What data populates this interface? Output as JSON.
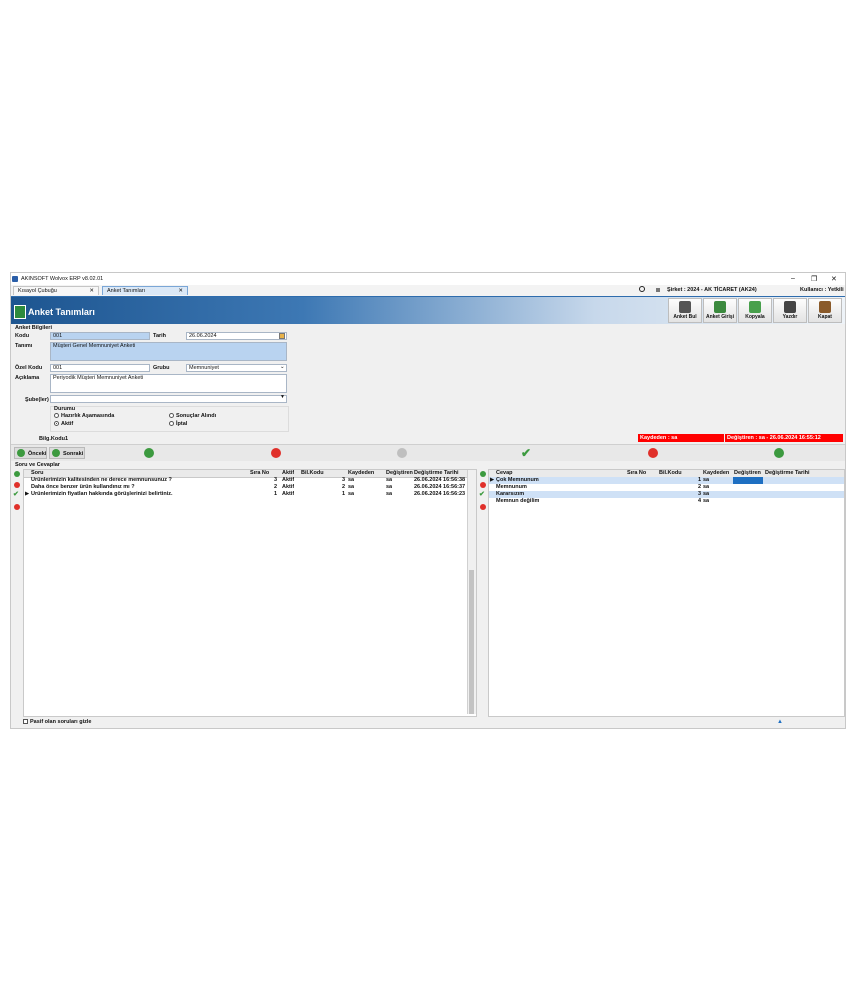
{
  "window": {
    "app_title": "AKINSOFT Wolvox ERP v8.02.01",
    "controls": {
      "minimize": "–",
      "restore": "❐",
      "close": "✕"
    },
    "company": "Şirket : 2024 - AK TİCARET (AK24)",
    "user": "Kullanıcı : Yetkili"
  },
  "tabs": [
    {
      "label": "Kısayol Çubuğu",
      "close": "✕"
    },
    {
      "label": "Anket Tanımları",
      "close": "✕"
    }
  ],
  "header": {
    "title": "Anket Tanımları"
  },
  "toolbar": [
    {
      "label": "Anket Bul",
      "icon": "camera-icon"
    },
    {
      "label": "Anket Girişi",
      "icon": "users-icon"
    },
    {
      "label": "Kopyala",
      "icon": "copy-icon"
    },
    {
      "label": "Yazdır",
      "icon": "printer-icon"
    },
    {
      "label": "Kapat",
      "icon": "door-icon"
    }
  ],
  "form": {
    "section_title": "Anket Bilgileri",
    "kodu_label": "Kodu",
    "kodu": "001",
    "tarih_label": "Tarih",
    "tarih": "26.06.2024",
    "tanimi_label": "Tanımı",
    "tanimi": "Müşteri Genel Memnuniyet Anketi",
    "ozel_kodu_label": "Özel Kodu",
    "ozel_kodu": "001",
    "grubu_label": "Grubu",
    "grubu": "Memnuniyet",
    "aciklama_label": "Açıklama",
    "aciklama": "Periyodik Müşteri Memnuniyet Anketi",
    "subeler_label": "Şube(ler)",
    "subeler": "",
    "durum_label": "Durumu",
    "durum_options": [
      {
        "label": "Hazırlık Aşamasında",
        "selected": false
      },
      {
        "label": "Sonuçlar Alındı",
        "selected": false
      },
      {
        "label": "Aktif",
        "selected": true
      },
      {
        "label": "İptal",
        "selected": false
      }
    ],
    "bilg_kodu_label": "Bilg.Kodu",
    "bilg_kodu": "1",
    "kaydeden": "Kaydeden : sa",
    "degistiren": "Değiştiren : sa - 26.06.2024 16:55:12"
  },
  "nav": {
    "prev": "Önceki",
    "next": "Sonraki"
  },
  "questions": {
    "section_title": "Soru ve Cevaplar",
    "columns": [
      "Soru",
      "Sıra No",
      "Aktif",
      "Bil.Kodu",
      "Kaydeden",
      "Değiştiren",
      "Değiştirme Tarihi"
    ],
    "rows": [
      {
        "soru": "Ürünlerimizin kalitesinden ne derece memnunsunuz ?",
        "sira": "3",
        "aktif": "Aktif",
        "bil": "3",
        "kaydeden": "sa",
        "degistiren": "sa",
        "tarih": "26.06.2024 16:56:38"
      },
      {
        "soru": "Daha önce benzer ürün kullandınız mı ?",
        "sira": "2",
        "aktif": "Aktif",
        "bil": "2",
        "kaydeden": "sa",
        "degistiren": "sa",
        "tarih": "26.06.2024 16:56:37"
      },
      {
        "soru": "Ürünlerimizin fiyatları hakkında görüşlerinizi belirtiniz.",
        "sira": "1",
        "aktif": "Aktif",
        "bil": "1",
        "kaydeden": "sa",
        "degistiren": "sa",
        "tarih": "26.06.2024 16:56:23"
      }
    ]
  },
  "answers": {
    "columns": [
      "Cevap",
      "Sıra No",
      "Bil.Kodu",
      "Kaydeden",
      "Değiştiren",
      "Değiştirme Tarihi"
    ],
    "rows": [
      {
        "cevap": "Çok Memnunum",
        "sira": "",
        "bil": "1",
        "kaydeden": "sa",
        "degistiren": "",
        "tarih": ""
      },
      {
        "cevap": "Memnunum",
        "sira": "",
        "bil": "2",
        "kaydeden": "sa",
        "degistiren": "",
        "tarih": ""
      },
      {
        "cevap": "Kararsızım",
        "sira": "",
        "bil": "3",
        "kaydeden": "sa",
        "degistiren": "",
        "tarih": ""
      },
      {
        "cevap": "Memnun değilim",
        "sira": "",
        "bil": "4",
        "kaydeden": "sa",
        "degistiren": "",
        "tarih": ""
      }
    ]
  },
  "footer": {
    "pasif_label": "Pasif olan soruları gizle"
  },
  "colors": {
    "accent": "#1d5590",
    "red_status": "#ff0000",
    "selection": "#b9d3f0"
  }
}
